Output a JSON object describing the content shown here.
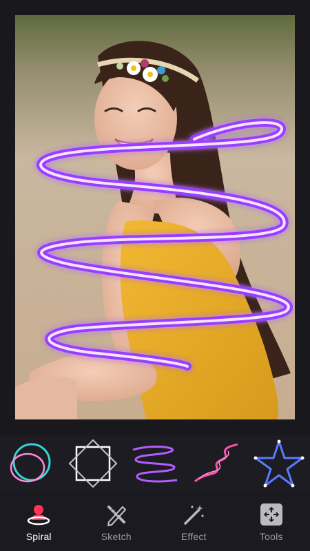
{
  "canvas": {
    "photo_description_icon": "photo-of-smiling-woman",
    "effect_color": "#9b3cff"
  },
  "effects": [
    {
      "icon": "neon-circle-icon",
      "color": "#35d6d0"
    },
    {
      "icon": "neon-square-icon",
      "color": "#ffffff"
    },
    {
      "icon": "neon-spiral-icon",
      "color": "#b45cff"
    },
    {
      "icon": "neon-zigzag-icon",
      "color": "#ff4fb0"
    },
    {
      "icon": "neon-star-icon",
      "color": "#5a7bff"
    }
  ],
  "nav": {
    "items": [
      {
        "label": "Spiral",
        "icon": "spiral-person-icon",
        "active": true
      },
      {
        "label": "Sketch",
        "icon": "pencil-ruler-icon",
        "active": false
      },
      {
        "label": "Effect",
        "icon": "magic-wand-icon",
        "active": false
      },
      {
        "label": "Tools",
        "icon": "tools-move-icon",
        "active": false
      }
    ]
  }
}
